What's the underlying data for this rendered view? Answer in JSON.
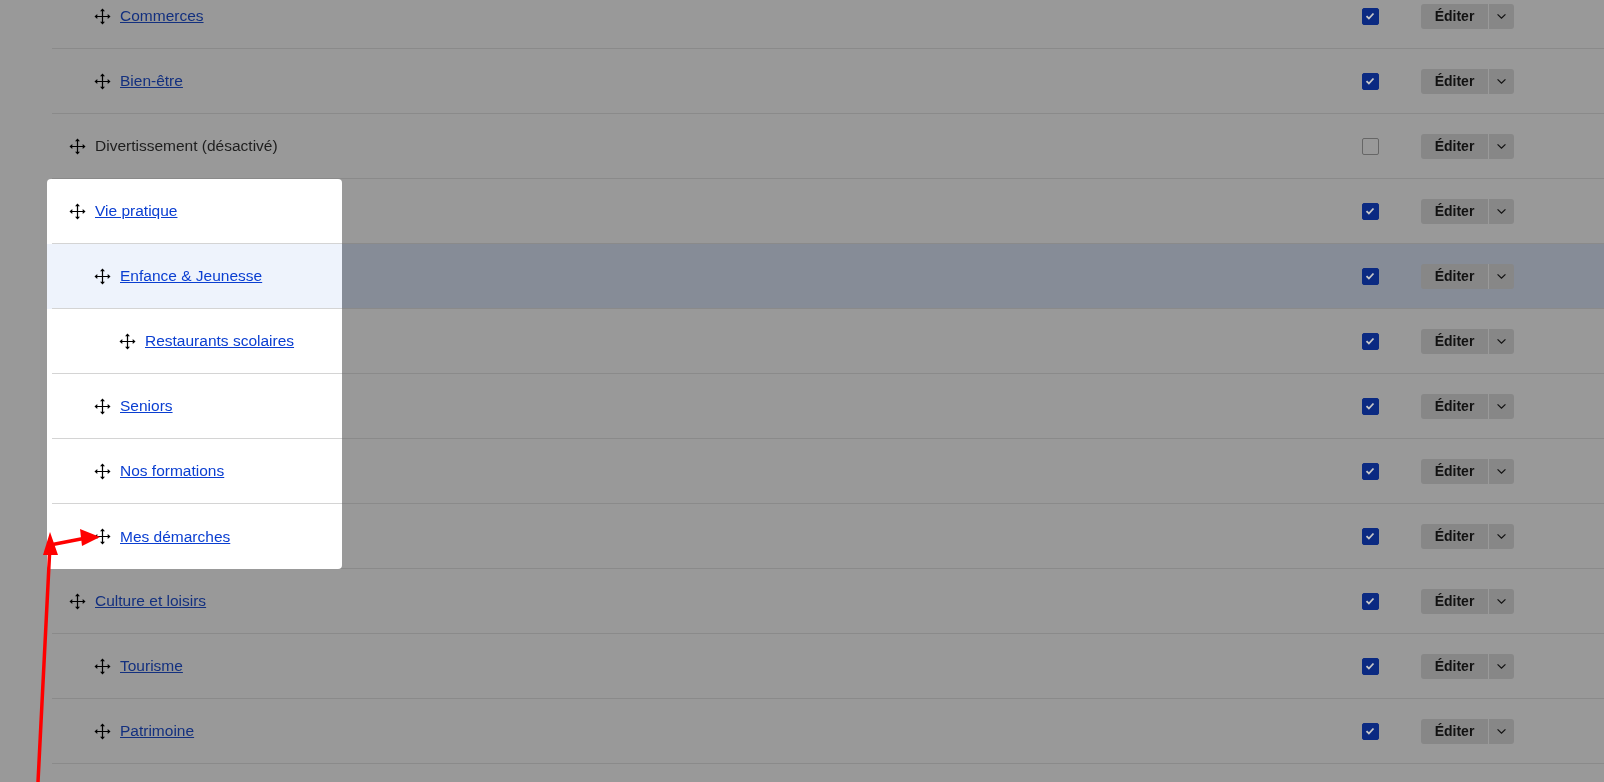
{
  "menu_rows": [
    {
      "children": [
        {
          "label": "Commerces",
          "link": true,
          "enabled": true,
          "spotlit": false,
          "highlighted": false,
          "edit_button": "Éditer"
        },
        {
          "label": "Bien-être",
          "link": true,
          "enabled": true,
          "spotlit": false,
          "highlighted": false,
          "edit_button": "Éditer"
        }
      ]
    },
    {
      "label": "Divertissement (désactivé)",
      "link": false,
      "enabled": false,
      "spotlit": false,
      "highlighted": false,
      "edit_button": "Éditer"
    },
    {
      "label": "Vie pratique",
      "link": true,
      "enabled": true,
      "spotlit": true,
      "highlighted": false,
      "edit_button": "Éditer",
      "children": [
        {
          "label": "Enfance & Jeunesse",
          "link": true,
          "enabled": true,
          "spotlit": true,
          "highlighted": true,
          "edit_button": "Éditer",
          "children": [
            {
              "label": "Restaurants scolaires",
              "link": true,
              "enabled": true,
              "spotlit": true,
              "highlighted": false,
              "edit_button": "Éditer"
            }
          ]
        },
        {
          "label": "Seniors",
          "link": true,
          "enabled": true,
          "spotlit": true,
          "highlighted": false,
          "edit_button": "Éditer"
        },
        {
          "label": "Nos formations",
          "link": true,
          "enabled": true,
          "spotlit": true,
          "highlighted": false,
          "edit_button": "Éditer"
        },
        {
          "label": "Mes démarches",
          "link": true,
          "enabled": true,
          "spotlit": true,
          "highlighted": false,
          "edit_button": "Éditer"
        }
      ]
    },
    {
      "label": "Culture et loisirs",
      "link": true,
      "enabled": true,
      "spotlit": false,
      "highlighted": false,
      "edit_button": "Éditer",
      "children": [
        {
          "label": "Tourisme",
          "link": true,
          "enabled": true,
          "spotlit": false,
          "highlighted": false,
          "edit_button": "Éditer"
        },
        {
          "label": "Patrimoine",
          "link": true,
          "enabled": true,
          "spotlit": false,
          "highlighted": false,
          "edit_button": "Éditer"
        }
      ]
    }
  ],
  "annotations": [
    {
      "kind": "arrow"
    }
  ]
}
